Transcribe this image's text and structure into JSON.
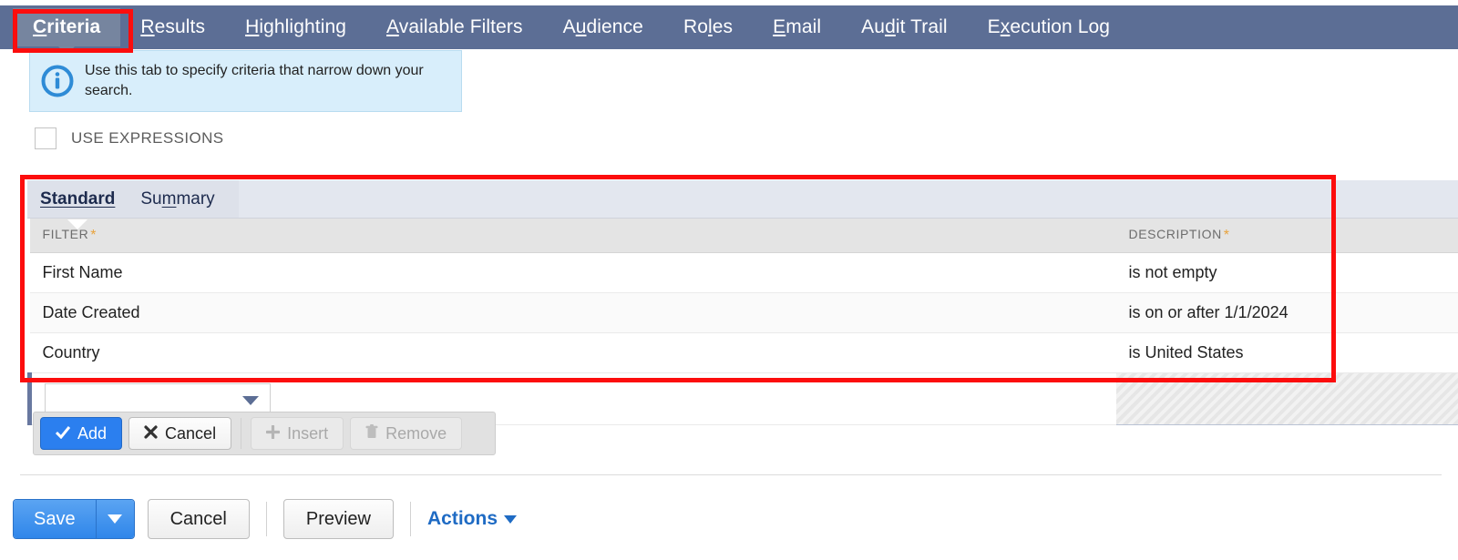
{
  "topnav": {
    "tabs": [
      {
        "label": "Criteria",
        "accel": "C",
        "active": true
      },
      {
        "label": "Results",
        "accel": "R",
        "active": false
      },
      {
        "label": "Highlighting",
        "accel": "H",
        "active": false
      },
      {
        "label": "Available Filters",
        "accel": "A",
        "active": false
      },
      {
        "label": "Audience",
        "accel": "u",
        "active": false
      },
      {
        "label": "Roles",
        "accel": "l",
        "active": false
      },
      {
        "label": "Email",
        "accel": "E",
        "active": false
      },
      {
        "label": "Audit Trail",
        "accel": "d",
        "active": false
      },
      {
        "label": "Execution Log",
        "accel": "x",
        "active": false
      }
    ]
  },
  "info_banner": {
    "icon": "info-circle-icon",
    "text": "Use this tab to specify criteria that narrow down your search."
  },
  "use_expressions": {
    "label": "USE EXPRESSIONS",
    "checked": false
  },
  "grid": {
    "subtabs": [
      {
        "label": "Standard",
        "accel": "S",
        "active": true
      },
      {
        "label": "Summary",
        "accel": "m",
        "active": false
      }
    ],
    "columns": [
      {
        "label": "FILTER",
        "required": true
      },
      {
        "label": "DESCRIPTION",
        "required": true
      }
    ],
    "required_marker": "*",
    "rows": [
      {
        "filter": "First Name",
        "description": "is not empty"
      },
      {
        "filter": "Date Created",
        "description": "is on or after 1/1/2024"
      },
      {
        "filter": "Country",
        "description": "is United States"
      }
    ],
    "new_row": {
      "filter_value": "",
      "filter_placeholder": "",
      "description_disabled": true
    }
  },
  "row_toolbar": {
    "buttons": [
      {
        "label": "Add",
        "icon": "check-icon",
        "style": "primary",
        "disabled": false
      },
      {
        "label": "Cancel",
        "icon": "x-icon",
        "style": "default",
        "disabled": false
      },
      {
        "label": "Insert",
        "icon": "plus-icon",
        "style": "default",
        "disabled": true
      },
      {
        "label": "Remove",
        "icon": "trash-icon",
        "style": "default",
        "disabled": true
      }
    ]
  },
  "action_bar": {
    "save_label": "Save",
    "save_caret": "chevron-down-icon",
    "cancel_label": "Cancel",
    "preview_label": "Preview",
    "actions_label": "Actions"
  },
  "annotations": {
    "highlight_color": "#fc0d0d",
    "boxes": [
      {
        "name": "criteria-tab-highlight"
      },
      {
        "name": "criteria-grid-highlight"
      }
    ]
  }
}
